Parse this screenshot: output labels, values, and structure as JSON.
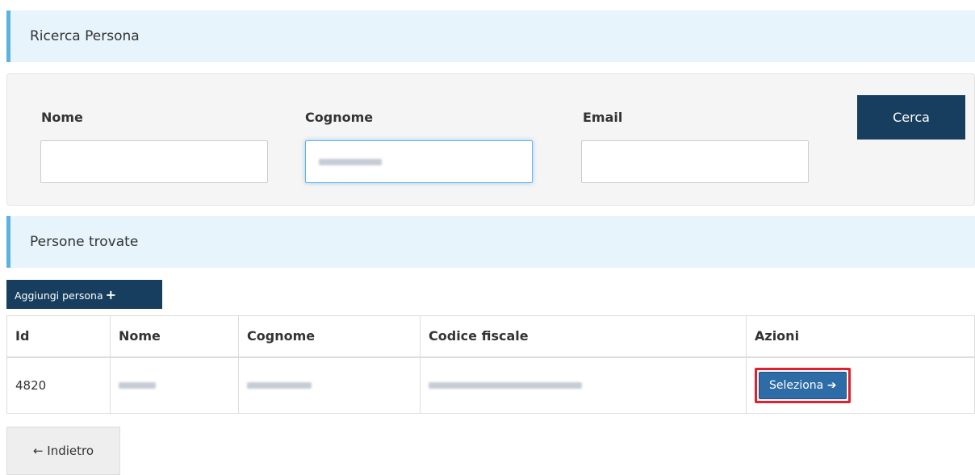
{
  "search_section": {
    "title": "Ricerca Persona"
  },
  "search_form": {
    "nome_label": "Nome",
    "cognome_label": "Cognome",
    "email_label": "Email",
    "search_button": "Cerca"
  },
  "results_section": {
    "title": "Persone trovate"
  },
  "add_button": {
    "label": "Aggiungi persona",
    "icon": "+"
  },
  "table": {
    "headers": [
      "Id",
      "Nome",
      "Cognome",
      "Codice fiscale",
      "Azioni"
    ],
    "rows": [
      {
        "id": "4820",
        "select_label": "Seleziona",
        "select_icon": "➔"
      }
    ]
  },
  "back_button": {
    "icon": "←",
    "label": "Indietro"
  },
  "colors": {
    "primary": "#173e5e",
    "select_button": "#2d6ca6",
    "highlight": "#e0202a",
    "header_bg": "#e8f4fb",
    "header_accent": "#5bb4e0"
  }
}
